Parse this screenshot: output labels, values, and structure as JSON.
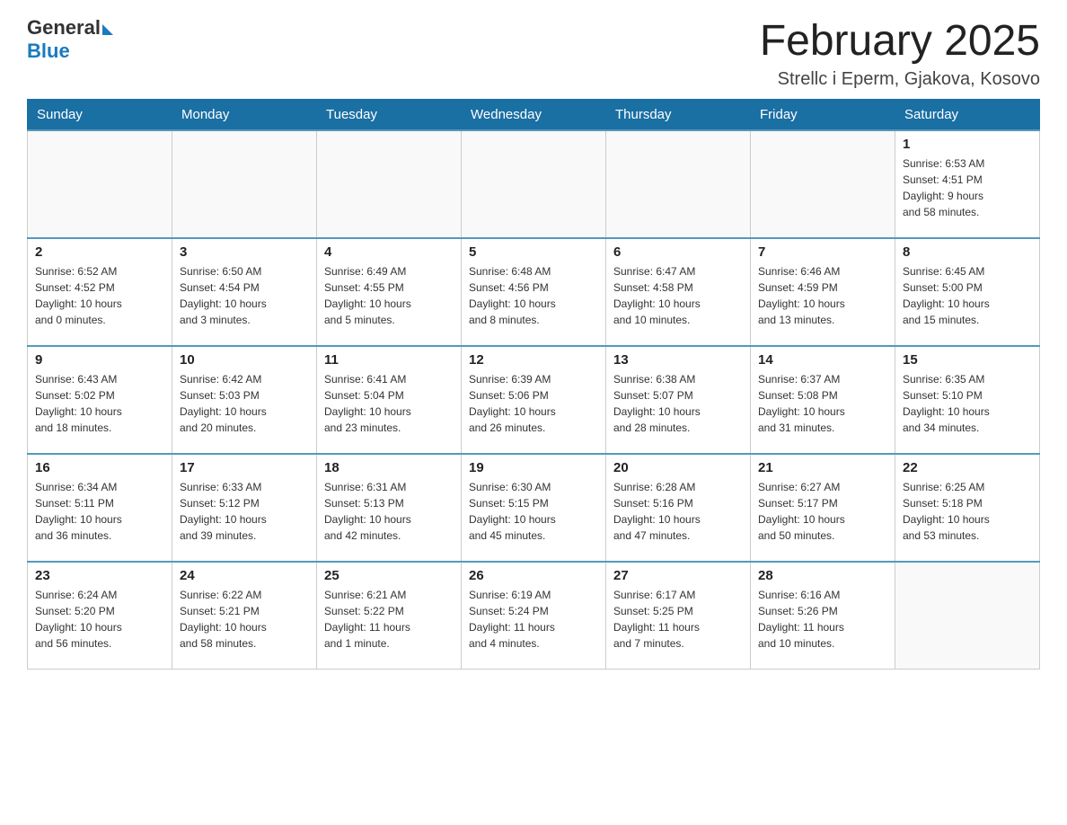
{
  "header": {
    "logo_general": "General",
    "logo_blue": "Blue",
    "month_title": "February 2025",
    "subtitle": "Strellc i Eperm, Gjakova, Kosovo"
  },
  "weekdays": [
    "Sunday",
    "Monday",
    "Tuesday",
    "Wednesday",
    "Thursday",
    "Friday",
    "Saturday"
  ],
  "weeks": [
    [
      {
        "day": "",
        "info": ""
      },
      {
        "day": "",
        "info": ""
      },
      {
        "day": "",
        "info": ""
      },
      {
        "day": "",
        "info": ""
      },
      {
        "day": "",
        "info": ""
      },
      {
        "day": "",
        "info": ""
      },
      {
        "day": "1",
        "info": "Sunrise: 6:53 AM\nSunset: 4:51 PM\nDaylight: 9 hours\nand 58 minutes."
      }
    ],
    [
      {
        "day": "2",
        "info": "Sunrise: 6:52 AM\nSunset: 4:52 PM\nDaylight: 10 hours\nand 0 minutes."
      },
      {
        "day": "3",
        "info": "Sunrise: 6:50 AM\nSunset: 4:54 PM\nDaylight: 10 hours\nand 3 minutes."
      },
      {
        "day": "4",
        "info": "Sunrise: 6:49 AM\nSunset: 4:55 PM\nDaylight: 10 hours\nand 5 minutes."
      },
      {
        "day": "5",
        "info": "Sunrise: 6:48 AM\nSunset: 4:56 PM\nDaylight: 10 hours\nand 8 minutes."
      },
      {
        "day": "6",
        "info": "Sunrise: 6:47 AM\nSunset: 4:58 PM\nDaylight: 10 hours\nand 10 minutes."
      },
      {
        "day": "7",
        "info": "Sunrise: 6:46 AM\nSunset: 4:59 PM\nDaylight: 10 hours\nand 13 minutes."
      },
      {
        "day": "8",
        "info": "Sunrise: 6:45 AM\nSunset: 5:00 PM\nDaylight: 10 hours\nand 15 minutes."
      }
    ],
    [
      {
        "day": "9",
        "info": "Sunrise: 6:43 AM\nSunset: 5:02 PM\nDaylight: 10 hours\nand 18 minutes."
      },
      {
        "day": "10",
        "info": "Sunrise: 6:42 AM\nSunset: 5:03 PM\nDaylight: 10 hours\nand 20 minutes."
      },
      {
        "day": "11",
        "info": "Sunrise: 6:41 AM\nSunset: 5:04 PM\nDaylight: 10 hours\nand 23 minutes."
      },
      {
        "day": "12",
        "info": "Sunrise: 6:39 AM\nSunset: 5:06 PM\nDaylight: 10 hours\nand 26 minutes."
      },
      {
        "day": "13",
        "info": "Sunrise: 6:38 AM\nSunset: 5:07 PM\nDaylight: 10 hours\nand 28 minutes."
      },
      {
        "day": "14",
        "info": "Sunrise: 6:37 AM\nSunset: 5:08 PM\nDaylight: 10 hours\nand 31 minutes."
      },
      {
        "day": "15",
        "info": "Sunrise: 6:35 AM\nSunset: 5:10 PM\nDaylight: 10 hours\nand 34 minutes."
      }
    ],
    [
      {
        "day": "16",
        "info": "Sunrise: 6:34 AM\nSunset: 5:11 PM\nDaylight: 10 hours\nand 36 minutes."
      },
      {
        "day": "17",
        "info": "Sunrise: 6:33 AM\nSunset: 5:12 PM\nDaylight: 10 hours\nand 39 minutes."
      },
      {
        "day": "18",
        "info": "Sunrise: 6:31 AM\nSunset: 5:13 PM\nDaylight: 10 hours\nand 42 minutes."
      },
      {
        "day": "19",
        "info": "Sunrise: 6:30 AM\nSunset: 5:15 PM\nDaylight: 10 hours\nand 45 minutes."
      },
      {
        "day": "20",
        "info": "Sunrise: 6:28 AM\nSunset: 5:16 PM\nDaylight: 10 hours\nand 47 minutes."
      },
      {
        "day": "21",
        "info": "Sunrise: 6:27 AM\nSunset: 5:17 PM\nDaylight: 10 hours\nand 50 minutes."
      },
      {
        "day": "22",
        "info": "Sunrise: 6:25 AM\nSunset: 5:18 PM\nDaylight: 10 hours\nand 53 minutes."
      }
    ],
    [
      {
        "day": "23",
        "info": "Sunrise: 6:24 AM\nSunset: 5:20 PM\nDaylight: 10 hours\nand 56 minutes."
      },
      {
        "day": "24",
        "info": "Sunrise: 6:22 AM\nSunset: 5:21 PM\nDaylight: 10 hours\nand 58 minutes."
      },
      {
        "day": "25",
        "info": "Sunrise: 6:21 AM\nSunset: 5:22 PM\nDaylight: 11 hours\nand 1 minute."
      },
      {
        "day": "26",
        "info": "Sunrise: 6:19 AM\nSunset: 5:24 PM\nDaylight: 11 hours\nand 4 minutes."
      },
      {
        "day": "27",
        "info": "Sunrise: 6:17 AM\nSunset: 5:25 PM\nDaylight: 11 hours\nand 7 minutes."
      },
      {
        "day": "28",
        "info": "Sunrise: 6:16 AM\nSunset: 5:26 PM\nDaylight: 11 hours\nand 10 minutes."
      },
      {
        "day": "",
        "info": ""
      }
    ]
  ]
}
